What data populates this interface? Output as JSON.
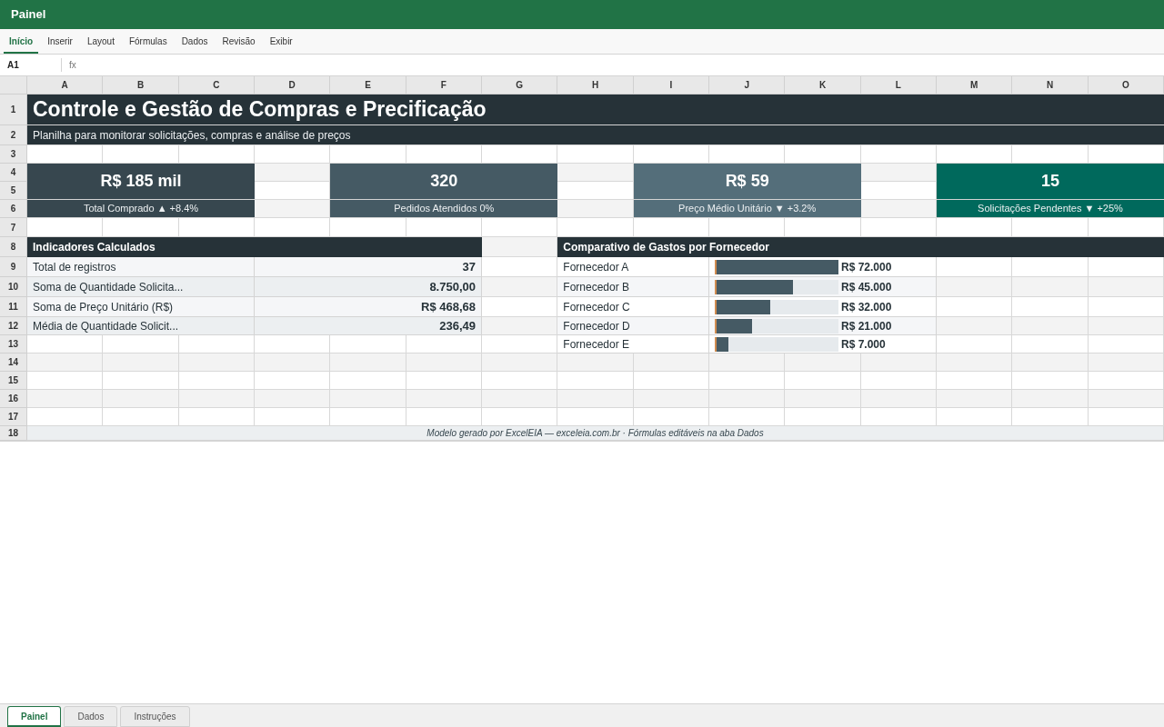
{
  "window": {
    "title": "Painel"
  },
  "ribbon_tabs": [
    {
      "label": "Início",
      "selected": true
    },
    {
      "label": "Inserir",
      "selected": false
    },
    {
      "label": "Layout",
      "selected": false
    },
    {
      "label": "Fórmulas",
      "selected": false
    },
    {
      "label": "Dados",
      "selected": false
    },
    {
      "label": "Revisão",
      "selected": false
    },
    {
      "label": "Exibir",
      "selected": false
    }
  ],
  "formula_bar": {
    "cell": "A1",
    "fx": "fx"
  },
  "columns": [
    "A",
    "B",
    "C",
    "D",
    "E",
    "F",
    "G",
    "H",
    "I",
    "J",
    "K",
    "L",
    "M",
    "N",
    "O"
  ],
  "rows": [
    "1",
    "2",
    "3",
    "4",
    "5",
    "6",
    "7",
    "8",
    "9",
    "10",
    "11",
    "12",
    "13",
    "14",
    "15",
    "16",
    "17",
    "18"
  ],
  "title": "Controle e Gestão de Compras e Precificação",
  "subtitle": "Planilha para monitorar solicitações, compras e análise de preços",
  "kpis": [
    {
      "value": "R$ 185 mil",
      "label": "Total Comprado ▲ +8.4%",
      "color": "#37474f"
    },
    {
      "value": "320",
      "label": "Pedidos Atendidos 0%",
      "color": "#455a64"
    },
    {
      "value": "R$ 59",
      "label": "Preço Médio Unitário ▼ +3.2%",
      "color": "#546e7a"
    },
    {
      "value": "15",
      "label": "Solicitações Pendentes ▼ +25%",
      "color": "#00695c"
    }
  ],
  "indicators": {
    "title": "Indicadores Calculados",
    "rows": [
      {
        "label": "Total de registros",
        "value": "37"
      },
      {
        "label": "Soma de Quantidade Solicita...",
        "value": "8.750,00"
      },
      {
        "label": "Soma de Preço Unitário (R$)",
        "value": "R$ 468,68"
      },
      {
        "label": "Média de Quantidade Solicit...",
        "value": "236,49"
      }
    ]
  },
  "suppliers": {
    "title": "Comparativo de Gastos por Fornecedor",
    "rows": [
      {
        "name": "Fornecedor A",
        "level": 1.0,
        "reading": "R$ 72.000"
      },
      {
        "name": "Fornecedor B",
        "level": 0.625,
        "reading": "R$ 45.000"
      },
      {
        "name": "Fornecedor C",
        "level": 0.444,
        "reading": "R$ 32.000"
      },
      {
        "name": "Fornecedor D",
        "level": 0.292,
        "reading": "R$ 21.000"
      },
      {
        "name": "Fornecedor E",
        "level": 0.097,
        "reading": "R$ 7.000"
      }
    ]
  },
  "footer": "Modelo gerado por ExcelEIA — exceleia.com.br · Fórmulas editáveis na aba Dados",
  "sheet_tabs": [
    {
      "label": "Painel",
      "selected": true
    },
    {
      "label": "Dados",
      "selected": false
    },
    {
      "label": "Instruções",
      "selected": false
    }
  ]
}
